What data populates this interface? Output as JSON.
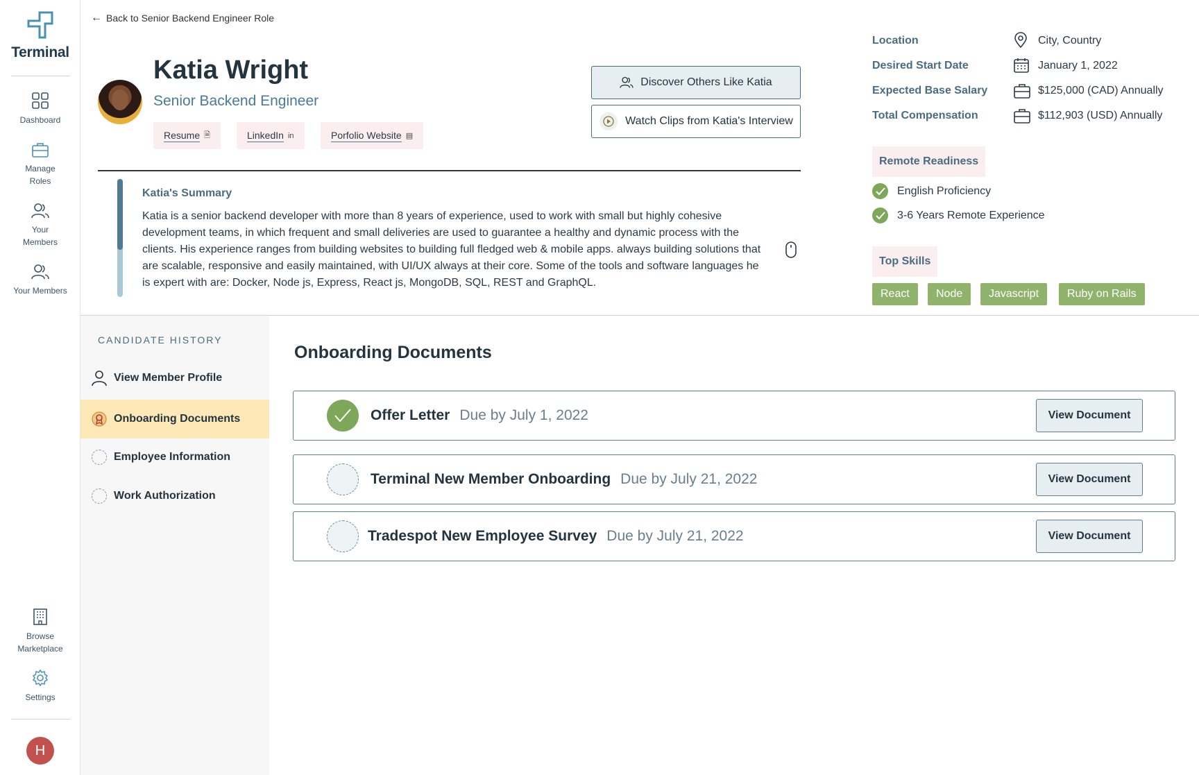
{
  "app": {
    "brand": "Terminal"
  },
  "nav": {
    "items": [
      {
        "label": "Dashboard"
      },
      {
        "label": "Manage Roles"
      },
      {
        "label": "Your Members"
      },
      {
        "label": "Your Members"
      }
    ],
    "bottom": [
      {
        "label": "Browse Marketplace"
      },
      {
        "label": "Settings"
      }
    ],
    "avatar_initial": "H"
  },
  "header": {
    "back_label": "Back to Senior Backend Engineer Role",
    "name": "Katia Wright",
    "role": "Senior Backend Engineer",
    "links": [
      "Resume",
      "LinkedIn",
      "Porfolio Website"
    ],
    "discover_label": "Discover Others Like Katia",
    "clips_label": "Watch Clips from Katia's Interview"
  },
  "summary": {
    "title": "Katia's Summary",
    "text": "Katia is a senior backend developer with more than 8 years of experience, used to work with small but highly cohesive development teams, in which frequent and small deliveries are used to guarantee a healthy and dynamic process with the clients. His experience ranges from building websites to building full fledged web & mobile apps. always building solutions that are scalable, responsive and easily maintained, with UI/UX always at their core. Some of the tools and software languages he is expert with are: Docker, Node js, Express, React js, MongoDB, SQL, REST and GraphQL."
  },
  "details": {
    "location_label": "Location",
    "location_value": "City, Country",
    "start_label": "Desired Start Date",
    "start_value": "January 1, 2022",
    "salary_label": "Expected Base Salary",
    "salary_value": "$125,000 (CAD) Annually",
    "comp_label": "Total Compensation",
    "comp_value": "$112,903 (USD) Annually"
  },
  "remote": {
    "title": "Remote Readiness",
    "items": [
      "English Proficiency",
      "3-6 Years Remote Experience"
    ]
  },
  "skills": {
    "title": "Top Skills",
    "items": [
      "React",
      "Node",
      "Javascript",
      "Ruby on Rails"
    ]
  },
  "history": {
    "title": "CANDIDATE HISTORY",
    "items": [
      {
        "label": "View Member Profile"
      },
      {
        "label": "Onboarding Documents"
      },
      {
        "label": "Employee Information"
      },
      {
        "label": "Work Authorization"
      }
    ],
    "active_index": 1
  },
  "documents": {
    "title": "Onboarding Documents",
    "items": [
      {
        "name": "Offer Letter",
        "due": "Due by July 1, 2022",
        "status": "complete",
        "action": "View Document"
      },
      {
        "name": "Terminal New Member Onboarding",
        "due": "Due by July 21, 2022",
        "status": "pending",
        "action": "View Document"
      },
      {
        "name": "Tradespot New Employee Survey",
        "due": "Due by July 21, 2022",
        "status": "pending",
        "action": "View Document"
      }
    ]
  },
  "colors": {
    "accent": "#4a7a96",
    "success": "#7da85a",
    "active_bg": "#fde9b8",
    "tag_bg": "#fbeeee"
  }
}
